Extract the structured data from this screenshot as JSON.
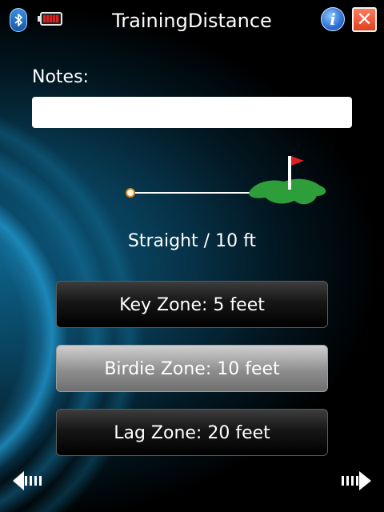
{
  "header": {
    "title": "TrainingDistance",
    "icons": [
      "bluetooth-icon",
      "battery-icon",
      "info-icon",
      "close-icon"
    ],
    "info_glyph": "i",
    "close_glyph": "✕"
  },
  "notes": {
    "label": "Notes:",
    "value": "",
    "placeholder": ""
  },
  "shot": {
    "label": "Straight / 10 ft"
  },
  "zones": [
    {
      "label": "Key Zone: 5 feet",
      "selected": false
    },
    {
      "label": "Birdie Zone: 10 feet",
      "selected": true
    },
    {
      "label": "Lag Zone: 20 feet",
      "selected": false
    }
  ],
  "nav": {
    "left_icon": "arrow-left-icon",
    "right_icon": "arrow-right-icon"
  },
  "colors": {
    "background": "#000000",
    "accent_blue": "#1e8cbe",
    "green": "#2e9e3a",
    "flag_red": "#e02020",
    "close_red": "#e0401f"
  }
}
